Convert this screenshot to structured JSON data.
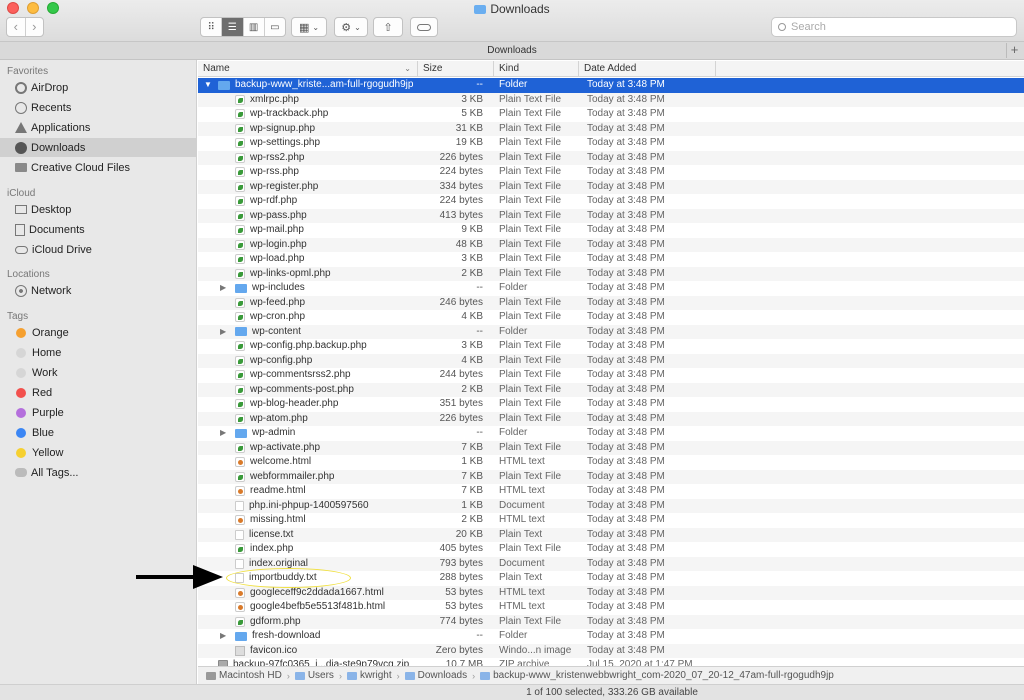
{
  "window": {
    "title": "Downloads",
    "tab_title": "Downloads"
  },
  "toolbar": {
    "back_icon": "chevron-left-icon",
    "forward_icon": "chevron-right-icon",
    "search_placeholder": "Search"
  },
  "sidebar": {
    "favorites_heading": "Favorites",
    "favorites": [
      {
        "label": "AirDrop",
        "icon": "airdrop-icon"
      },
      {
        "label": "Recents",
        "icon": "clock-icon"
      },
      {
        "label": "Applications",
        "icon": "applications-icon"
      },
      {
        "label": "Downloads",
        "icon": "downloads-icon",
        "selected": true
      },
      {
        "label": "Creative Cloud Files",
        "icon": "folder-icon"
      }
    ],
    "icloud_heading": "iCloud",
    "icloud": [
      {
        "label": "Desktop",
        "icon": "desktop-icon"
      },
      {
        "label": "Documents",
        "icon": "document-icon"
      },
      {
        "label": "iCloud Drive",
        "icon": "cloud-icon"
      }
    ],
    "locations_heading": "Locations",
    "locations": [
      {
        "label": "Network",
        "icon": "network-icon"
      }
    ],
    "tags_heading": "Tags",
    "tags": [
      {
        "label": "Orange",
        "color": "#f5a030"
      },
      {
        "label": "Home",
        "color": "#d6d6d6"
      },
      {
        "label": "Work",
        "color": "#d6d6d6"
      },
      {
        "label": "Red",
        "color": "#f2504d"
      },
      {
        "label": "Purple",
        "color": "#b46fdc"
      },
      {
        "label": "Blue",
        "color": "#3b86f4"
      },
      {
        "label": "Yellow",
        "color": "#f6d030"
      },
      {
        "label": "All Tags...",
        "color": ""
      }
    ]
  },
  "columns": {
    "name": "Name",
    "size": "Size",
    "kind": "Kind",
    "date": "Date Added"
  },
  "rows": [
    {
      "name": "backup-www_kriste...am-full-rgogudh9jp",
      "size": "--",
      "kind": "Folder",
      "date": "Today at 3:48 PM",
      "type": "folder",
      "level": 0,
      "disclosure": "expanded",
      "selected": true
    },
    {
      "name": "xmlrpc.php",
      "size": "3 KB",
      "kind": "Plain Text File",
      "date": "Today at 3:48 PM",
      "type": "php",
      "level": 1
    },
    {
      "name": "wp-trackback.php",
      "size": "5 KB",
      "kind": "Plain Text File",
      "date": "Today at 3:48 PM",
      "type": "php",
      "level": 1
    },
    {
      "name": "wp-signup.php",
      "size": "31 KB",
      "kind": "Plain Text File",
      "date": "Today at 3:48 PM",
      "type": "php",
      "level": 1
    },
    {
      "name": "wp-settings.php",
      "size": "19 KB",
      "kind": "Plain Text File",
      "date": "Today at 3:48 PM",
      "type": "php",
      "level": 1
    },
    {
      "name": "wp-rss2.php",
      "size": "226 bytes",
      "kind": "Plain Text File",
      "date": "Today at 3:48 PM",
      "type": "php",
      "level": 1
    },
    {
      "name": "wp-rss.php",
      "size": "224 bytes",
      "kind": "Plain Text File",
      "date": "Today at 3:48 PM",
      "type": "php",
      "level": 1
    },
    {
      "name": "wp-register.php",
      "size": "334 bytes",
      "kind": "Plain Text File",
      "date": "Today at 3:48 PM",
      "type": "php",
      "level": 1
    },
    {
      "name": "wp-rdf.php",
      "size": "224 bytes",
      "kind": "Plain Text File",
      "date": "Today at 3:48 PM",
      "type": "php",
      "level": 1
    },
    {
      "name": "wp-pass.php",
      "size": "413 bytes",
      "kind": "Plain Text File",
      "date": "Today at 3:48 PM",
      "type": "php",
      "level": 1
    },
    {
      "name": "wp-mail.php",
      "size": "9 KB",
      "kind": "Plain Text File",
      "date": "Today at 3:48 PM",
      "type": "php",
      "level": 1
    },
    {
      "name": "wp-login.php",
      "size": "48 KB",
      "kind": "Plain Text File",
      "date": "Today at 3:48 PM",
      "type": "php",
      "level": 1
    },
    {
      "name": "wp-load.php",
      "size": "3 KB",
      "kind": "Plain Text File",
      "date": "Today at 3:48 PM",
      "type": "php",
      "level": 1
    },
    {
      "name": "wp-links-opml.php",
      "size": "2 KB",
      "kind": "Plain Text File",
      "date": "Today at 3:48 PM",
      "type": "php",
      "level": 1
    },
    {
      "name": "wp-includes",
      "size": "--",
      "kind": "Folder",
      "date": "Today at 3:48 PM",
      "type": "folder",
      "level": 1,
      "disclosure": "collapsed"
    },
    {
      "name": "wp-feed.php",
      "size": "246 bytes",
      "kind": "Plain Text File",
      "date": "Today at 3:48 PM",
      "type": "php",
      "level": 1
    },
    {
      "name": "wp-cron.php",
      "size": "4 KB",
      "kind": "Plain Text File",
      "date": "Today at 3:48 PM",
      "type": "php",
      "level": 1
    },
    {
      "name": "wp-content",
      "size": "--",
      "kind": "Folder",
      "date": "Today at 3:48 PM",
      "type": "folder",
      "level": 1,
      "disclosure": "collapsed"
    },
    {
      "name": "wp-config.php.backup.php",
      "size": "3 KB",
      "kind": "Plain Text File",
      "date": "Today at 3:48 PM",
      "type": "php",
      "level": 1
    },
    {
      "name": "wp-config.php",
      "size": "4 KB",
      "kind": "Plain Text File",
      "date": "Today at 3:48 PM",
      "type": "php",
      "level": 1
    },
    {
      "name": "wp-commentsrss2.php",
      "size": "244 bytes",
      "kind": "Plain Text File",
      "date": "Today at 3:48 PM",
      "type": "php",
      "level": 1
    },
    {
      "name": "wp-comments-post.php",
      "size": "2 KB",
      "kind": "Plain Text File",
      "date": "Today at 3:48 PM",
      "type": "php",
      "level": 1
    },
    {
      "name": "wp-blog-header.php",
      "size": "351 bytes",
      "kind": "Plain Text File",
      "date": "Today at 3:48 PM",
      "type": "php",
      "level": 1
    },
    {
      "name": "wp-atom.php",
      "size": "226 bytes",
      "kind": "Plain Text File",
      "date": "Today at 3:48 PM",
      "type": "php",
      "level": 1
    },
    {
      "name": "wp-admin",
      "size": "--",
      "kind": "Folder",
      "date": "Today at 3:48 PM",
      "type": "folder",
      "level": 1,
      "disclosure": "collapsed"
    },
    {
      "name": "wp-activate.php",
      "size": "7 KB",
      "kind": "Plain Text File",
      "date": "Today at 3:48 PM",
      "type": "php",
      "level": 1
    },
    {
      "name": "welcome.html",
      "size": "1 KB",
      "kind": "HTML text",
      "date": "Today at 3:48 PM",
      "type": "html",
      "level": 1
    },
    {
      "name": "webformmailer.php",
      "size": "7 KB",
      "kind": "Plain Text File",
      "date": "Today at 3:48 PM",
      "type": "php",
      "level": 1
    },
    {
      "name": "readme.html",
      "size": "7 KB",
      "kind": "HTML text",
      "date": "Today at 3:48 PM",
      "type": "html",
      "level": 1
    },
    {
      "name": "php.ini-phpup-1400597560",
      "size": "1 KB",
      "kind": "Document",
      "date": "Today at 3:48 PM",
      "type": "doc",
      "level": 1
    },
    {
      "name": "missing.html",
      "size": "2 KB",
      "kind": "HTML text",
      "date": "Today at 3:48 PM",
      "type": "html",
      "level": 1
    },
    {
      "name": "license.txt",
      "size": "20 KB",
      "kind": "Plain Text",
      "date": "Today at 3:48 PM",
      "type": "doc",
      "level": 1
    },
    {
      "name": "index.php",
      "size": "405 bytes",
      "kind": "Plain Text File",
      "date": "Today at 3:48 PM",
      "type": "php",
      "level": 1
    },
    {
      "name": "index.original",
      "size": "793 bytes",
      "kind": "Document",
      "date": "Today at 3:48 PM",
      "type": "doc",
      "level": 1
    },
    {
      "name": "importbuddy.txt",
      "size": "288 bytes",
      "kind": "Plain Text",
      "date": "Today at 3:48 PM",
      "type": "doc",
      "level": 1
    },
    {
      "name": "googleceff9c2ddada1667.html",
      "size": "53 bytes",
      "kind": "HTML text",
      "date": "Today at 3:48 PM",
      "type": "html",
      "level": 1
    },
    {
      "name": "google4befb5e5513f481b.html",
      "size": "53 bytes",
      "kind": "HTML text",
      "date": "Today at 3:48 PM",
      "type": "html",
      "level": 1
    },
    {
      "name": "gdform.php",
      "size": "774 bytes",
      "kind": "Plain Text File",
      "date": "Today at 3:48 PM",
      "type": "php",
      "level": 1
    },
    {
      "name": "fresh-download",
      "size": "--",
      "kind": "Folder",
      "date": "Today at 3:48 PM",
      "type": "folder",
      "level": 1,
      "disclosure": "collapsed"
    },
    {
      "name": "favicon.ico",
      "size": "Zero bytes",
      "kind": "Windo...n image",
      "date": "Today at 3:48 PM",
      "type": "ico",
      "level": 1
    },
    {
      "name": "backup-97fc0365_i...dia-ste9p79vcg.zip",
      "size": "10.7 MB",
      "kind": "ZIP archive",
      "date": "Jul 15, 2020 at 1:47 PM",
      "type": "zip",
      "level": 0
    }
  ],
  "pathbar": [
    {
      "label": "Macintosh HD",
      "icon": "hard-drive-icon"
    },
    {
      "label": "Users",
      "icon": "folder-icon"
    },
    {
      "label": "kwright",
      "icon": "home-icon"
    },
    {
      "label": "Downloads",
      "icon": "folder-icon"
    },
    {
      "label": "backup-www_kristenwebbwright_com-2020_07_20-12_47am-full-rgogudh9jp",
      "icon": "folder-icon"
    }
  ],
  "status": "1 of 100 selected, 333.26 GB available"
}
